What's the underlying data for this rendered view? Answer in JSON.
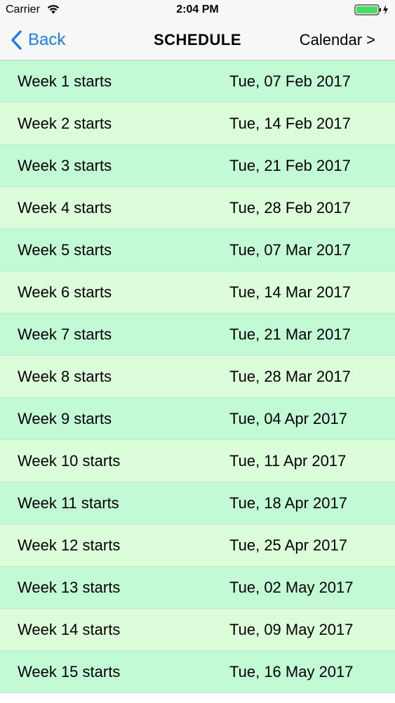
{
  "status_bar": {
    "carrier": "Carrier",
    "time": "2:04 PM",
    "battery_color": "#4cd964"
  },
  "nav": {
    "back_label": "Back",
    "title": "SCHEDULE",
    "calendar_label": "Calendar >",
    "tint_color": "#1a7cf5"
  },
  "schedule": {
    "row_colors": [
      "#c3fad6",
      "#dcfdd9"
    ],
    "rows": [
      {
        "label": "Week 1 starts",
        "date": "Tue, 07 Feb 2017"
      },
      {
        "label": "Week 2 starts",
        "date": "Tue, 14 Feb 2017"
      },
      {
        "label": "Week 3 starts",
        "date": "Tue, 21 Feb 2017"
      },
      {
        "label": "Week 4 starts",
        "date": "Tue, 28 Feb 2017"
      },
      {
        "label": "Week 5 starts",
        "date": "Tue, 07 Mar 2017"
      },
      {
        "label": "Week 6 starts",
        "date": "Tue, 14 Mar 2017"
      },
      {
        "label": "Week 7 starts",
        "date": "Tue, 21 Mar 2017"
      },
      {
        "label": "Week 8 starts",
        "date": "Tue, 28 Mar 2017"
      },
      {
        "label": "Week 9 starts",
        "date": "Tue, 04 Apr 2017"
      },
      {
        "label": "Week 10 starts",
        "date": "Tue, 11 Apr 2017"
      },
      {
        "label": "Week 11 starts",
        "date": "Tue, 18 Apr 2017"
      },
      {
        "label": "Week 12 starts",
        "date": "Tue, 25 Apr 2017"
      },
      {
        "label": "Week 13 starts",
        "date": "Tue, 02 May 2017"
      },
      {
        "label": "Week 14 starts",
        "date": "Tue, 09 May 2017"
      },
      {
        "label": "Week 15 starts",
        "date": "Tue, 16 May 2017"
      }
    ]
  }
}
